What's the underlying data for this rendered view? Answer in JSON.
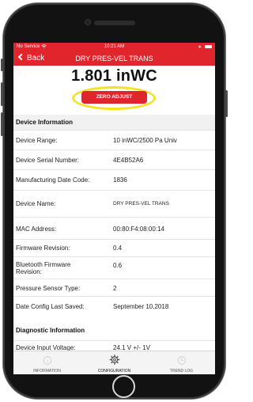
{
  "status_bar": {
    "carrier": "No Service",
    "time": "10:21 AM",
    "bluetooth": "∗"
  },
  "nav": {
    "back_label": "Back",
    "title": "DRY PRES-VEL TRANS"
  },
  "reading": "1.801 inWC",
  "zero_adjust_label": "ZERO ADJUST",
  "device_info": {
    "title": "Device Information",
    "rows": [
      {
        "label": "Device Range:",
        "value": "10 inWC/2500 Pa Univ"
      },
      {
        "label": "Device Serial Number:",
        "value": "4E4B52A6"
      },
      {
        "label": "Manufacturing Date Code:",
        "value": "1836"
      },
      {
        "label": "Device Name:",
        "value": "DRY PRES-VEL TRANS"
      },
      {
        "label": "MAC Address:",
        "value": "00:80:F4:08:00:14"
      },
      {
        "label": "Firmware Revision:",
        "value": "0.4"
      },
      {
        "label": "Bluetooth Firmware Revision:",
        "value": "0.6"
      },
      {
        "label": "Pressure Sensor Type:",
        "value": "2"
      },
      {
        "label": "Date Config Last Saved:",
        "value": "September 10,2018"
      }
    ]
  },
  "diagnostic_info": {
    "title": "Diagnostic Information",
    "rows": [
      {
        "label": "Device Input Voltage:",
        "value": "24.1 V +/- 1V"
      }
    ]
  },
  "tabs": [
    {
      "label": "INFORMATION",
      "icon": "info-icon"
    },
    {
      "label": "CONFIGURATION",
      "icon": "gear-icon"
    },
    {
      "label": "TREND LOG",
      "icon": "clock-icon"
    }
  ],
  "colors": {
    "accent": "#e0252c",
    "highlight": "#f4e225"
  }
}
